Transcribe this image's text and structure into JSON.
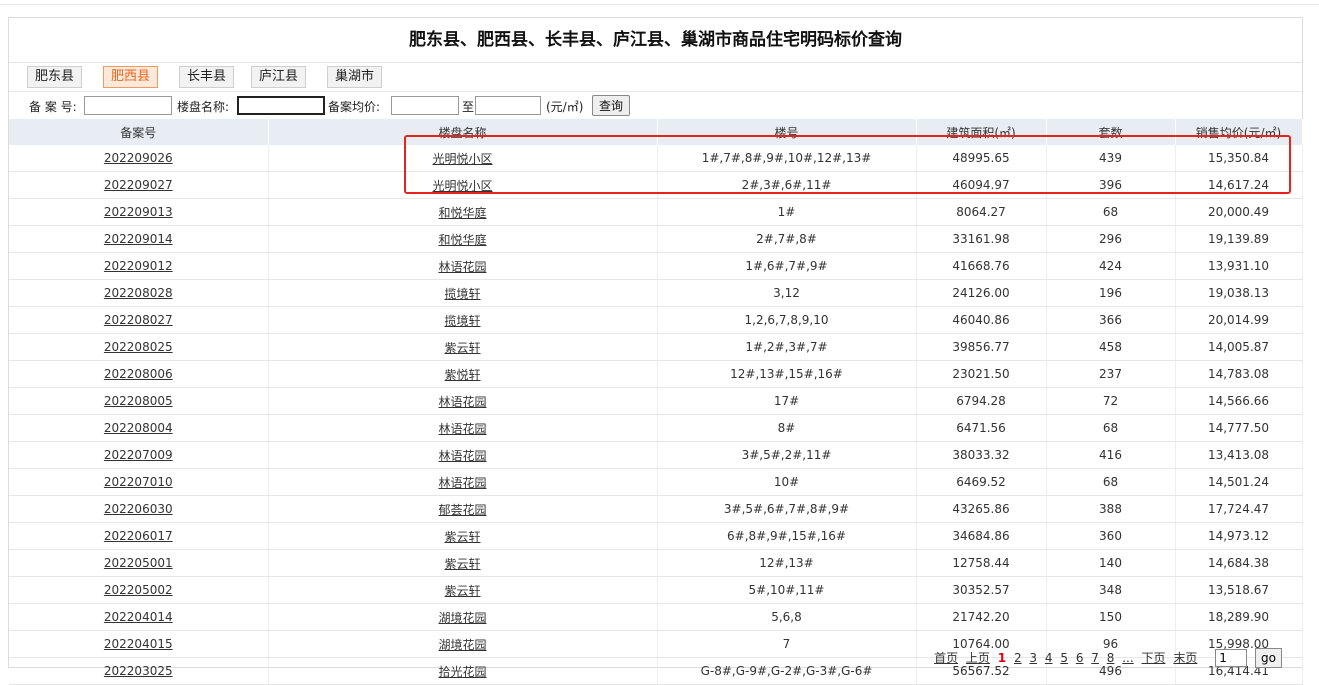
{
  "title": "肥东县、肥西县、长丰县、庐江县、巢湖市商品住宅明码标价查询",
  "tabs": [
    {
      "label": "肥东县",
      "active": false
    },
    {
      "label": "肥西县",
      "active": true
    },
    {
      "label": "长丰县",
      "active": false
    },
    {
      "label": "庐江县",
      "active": false
    },
    {
      "label": "巢湖市",
      "active": false
    }
  ],
  "filters": {
    "record_no_label": "备 案 号:",
    "project_name_label": "楼盘名称:",
    "avg_price_label": "备案均价:",
    "to_label": "至",
    "unit_label": "(元/㎡)",
    "query_button": "查询",
    "record_no_value": "",
    "project_name_value": "",
    "price_from_value": "",
    "price_to_value": ""
  },
  "table": {
    "headers": [
      "备案号",
      "楼盘名称",
      "楼号",
      "建筑面积(㎡)",
      "套数",
      "销售均价(元/㎡)"
    ],
    "rows": [
      [
        "202209026",
        "光明悦小区",
        "1#,7#,8#,9#,10#,12#,13#",
        "48995.65",
        "439",
        "15,350.84"
      ],
      [
        "202209027",
        "光明悦小区",
        "2#,3#,6#,11#",
        "46094.97",
        "396",
        "14,617.24"
      ],
      [
        "202209013",
        "和悦华庭",
        "1#",
        "8064.27",
        "68",
        "20,000.49"
      ],
      [
        "202209014",
        "和悦华庭",
        "2#,7#,8#",
        "33161.98",
        "296",
        "19,139.89"
      ],
      [
        "202209012",
        "林语花园",
        "1#,6#,7#,9#",
        "41668.76",
        "424",
        "13,931.10"
      ],
      [
        "202208028",
        "揽境轩",
        "3,12",
        "24126.00",
        "196",
        "19,038.13"
      ],
      [
        "202208027",
        "揽境轩",
        "1,2,6,7,8,9,10",
        "46040.86",
        "366",
        "20,014.99"
      ],
      [
        "202208025",
        "紫云轩",
        "1#,2#,3#,7#",
        "39856.77",
        "458",
        "14,005.87"
      ],
      [
        "202208006",
        "紫悦轩",
        "12#,13#,15#,16#",
        "23021.50",
        "237",
        "14,783.08"
      ],
      [
        "202208005",
        "林语花园",
        "17#",
        "6794.28",
        "72",
        "14,566.66"
      ],
      [
        "202208004",
        "林语花园",
        "8#",
        "6471.56",
        "68",
        "14,777.50"
      ],
      [
        "202207009",
        "林语花园",
        "3#,5#,2#,11#",
        "38033.32",
        "416",
        "13,413.08"
      ],
      [
        "202207010",
        "林语花园",
        "10#",
        "6469.52",
        "68",
        "14,501.24"
      ],
      [
        "202206030",
        "郁荟花园",
        "3#,5#,6#,7#,8#,9#",
        "43265.86",
        "388",
        "17,724.47"
      ],
      [
        "202206017",
        "紫云轩",
        "6#,8#,9#,15#,16#",
        "34684.86",
        "360",
        "14,973.12"
      ],
      [
        "202205001",
        "紫云轩",
        "12#,13#",
        "12758.44",
        "140",
        "14,684.38"
      ],
      [
        "202205002",
        "紫云轩",
        "5#,10#,11#",
        "30352.57",
        "348",
        "13,518.67"
      ],
      [
        "202204014",
        "湖境花园",
        "5,6,8",
        "21742.20",
        "150",
        "18,289.90"
      ],
      [
        "202204015",
        "湖境花园",
        "7",
        "10764.00",
        "96",
        "15,998.00"
      ],
      [
        "202203025",
        "拾光花园",
        "G-8#,G-9#,G-2#,G-3#,G-6#",
        "56567.52",
        "496",
        "16,414.41"
      ]
    ]
  },
  "pager": {
    "first": "首页",
    "prev": "上页",
    "current": "1",
    "pages": [
      "2",
      "3",
      "4",
      "5",
      "6",
      "7",
      "8"
    ],
    "ellipsis": "...",
    "next": "下页",
    "last": "末页",
    "page_input_value": "1",
    "go_button": "go"
  },
  "accent_colors": {
    "active_tab": "#e8651b",
    "current_page": "#e60012",
    "highlight_box": "#e8221e"
  }
}
